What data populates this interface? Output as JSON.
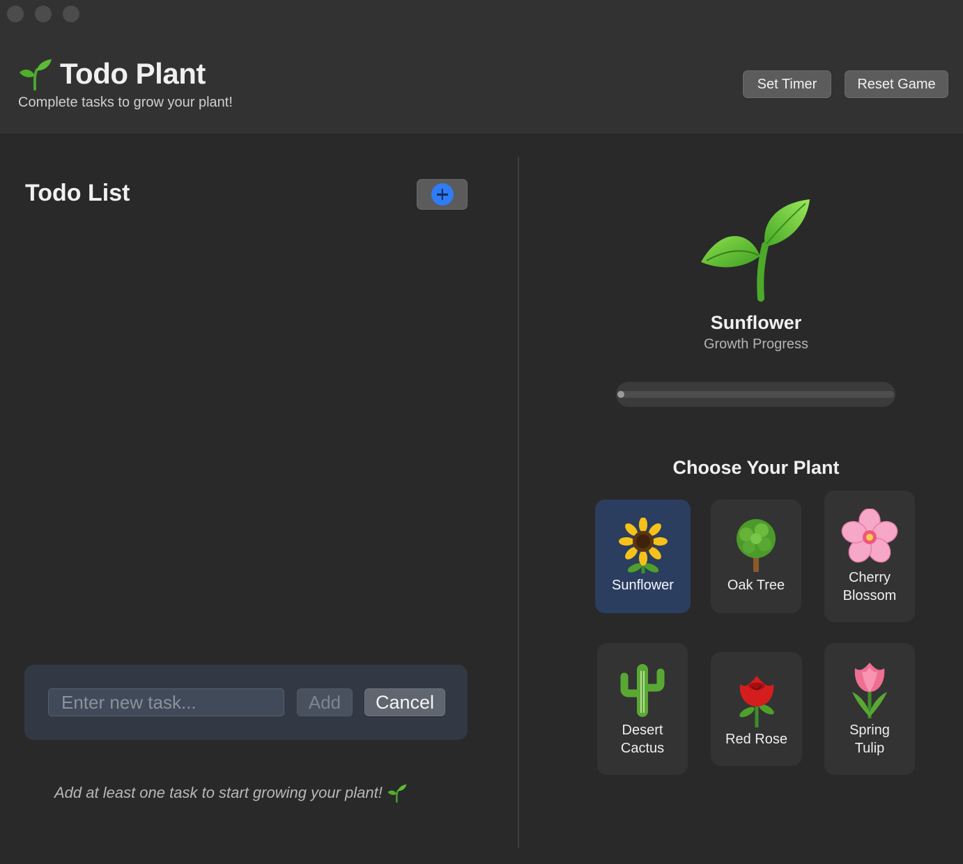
{
  "window": {
    "controls": [
      "close",
      "minimize",
      "zoom"
    ]
  },
  "header": {
    "title": "Todo Plant",
    "title_icon": "seedling-icon",
    "subtitle": "Complete tasks to grow your plant!",
    "set_timer_label": "Set Timer",
    "reset_game_label": "Reset Game"
  },
  "todo": {
    "heading": "Todo List",
    "add_toggle_icon": "plus-circle-icon",
    "items": [],
    "new_task": {
      "value": "",
      "placeholder": "Enter new task...",
      "add_label": "Add",
      "add_enabled": false,
      "cancel_label": "Cancel"
    },
    "hint": "Add at least one task to start growing your plant!",
    "hint_icon": "seedling-icon"
  },
  "plant": {
    "stage_icon": "seedling-icon",
    "name": "Sunflower",
    "progress_label": "Growth Progress",
    "progress": 0
  },
  "chooser": {
    "heading": "Choose Your Plant",
    "options": [
      {
        "label": "Sunflower",
        "icon": "sunflower-icon",
        "selected": true
      },
      {
        "label": "Oak Tree",
        "icon": "tree-icon",
        "selected": false
      },
      {
        "label": "Cherry\nBlossom",
        "icon": "cherry-blossom-icon",
        "selected": false
      },
      {
        "label": "Desert\nCactus",
        "icon": "cactus-icon",
        "selected": false
      },
      {
        "label": "Red Rose",
        "icon": "rose-icon",
        "selected": false
      },
      {
        "label": "Spring\nTulip",
        "icon": "tulip-icon",
        "selected": false
      }
    ]
  },
  "colors": {
    "accent": "#2f7cf6",
    "selected_card": "#2b3e5f",
    "background": "#292929",
    "header": "#323232"
  }
}
